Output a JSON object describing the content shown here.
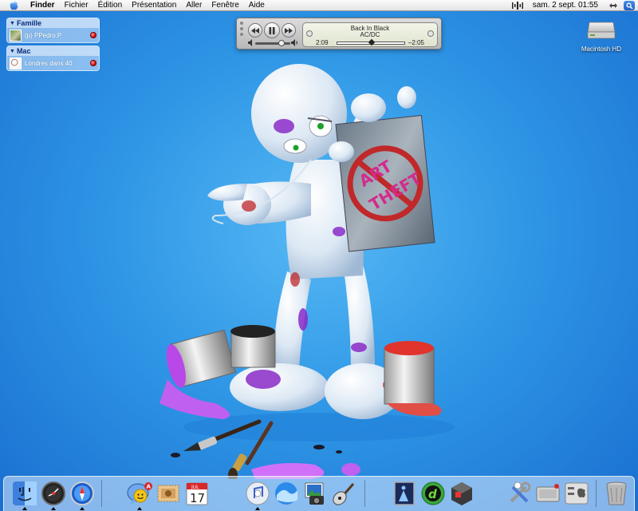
{
  "menubar": {
    "app_name": "Finder",
    "items": [
      "Fichier",
      "Édition",
      "Présentation",
      "Aller",
      "Fenêtre",
      "Aide"
    ],
    "clock": "sam. 2 sept. 01:55"
  },
  "buddy_list": {
    "groups": [
      {
        "name": "Famille",
        "buddies": [
          {
            "name": "(p) PPedro:P"
          }
        ]
      },
      {
        "name": "Mac",
        "buddies": [
          {
            "name": "Londres dans 40"
          }
        ]
      }
    ]
  },
  "itunes_player": {
    "track_title": "Back In Black",
    "artist": "AC/DC",
    "elapsed": "2:09",
    "remaining": "–2:05",
    "progress": 0.51,
    "volume": 0.75
  },
  "desktop": {
    "drive_label": "Macintosh HD"
  },
  "dock": {
    "apps": [
      {
        "id": "finder",
        "icon": "finder-icon",
        "running": true
      },
      {
        "id": "dashboard",
        "icon": "dashboard-icon",
        "running": true
      },
      {
        "id": "safari",
        "icon": "safari-icon",
        "running": true
      },
      {
        "id": "ichat",
        "icon": "ichat-icon",
        "running": true,
        "badge": "A"
      },
      {
        "id": "mail",
        "icon": "mail-stamp-icon",
        "running": false
      },
      {
        "id": "ical",
        "icon": "calendar-icon",
        "running": false,
        "date": "17",
        "month": "JUL"
      },
      {
        "id": "itunes",
        "icon": "itunes-icon",
        "running": true
      },
      {
        "id": "dvd",
        "icon": "wave-icon",
        "running": false
      },
      {
        "id": "iphoto",
        "icon": "iphoto-icon",
        "running": false
      },
      {
        "id": "garageband",
        "icon": "guitar-icon",
        "running": false
      },
      {
        "id": "preview",
        "icon": "preview-icon",
        "running": false
      },
      {
        "id": "dreamweaver",
        "icon": "dreamweaver-icon",
        "running": false
      },
      {
        "id": "omnigraffle",
        "icon": "cube-icon",
        "running": false
      },
      {
        "id": "utility",
        "icon": "tools-icon",
        "running": false
      },
      {
        "id": "disk",
        "icon": "disk-icon",
        "running": false
      },
      {
        "id": "prefs",
        "icon": "system-prefs-icon",
        "running": false
      },
      {
        "id": "trash",
        "icon": "trash-icon",
        "running": false
      }
    ]
  },
  "colors": {
    "desktop_blue": "#2f97e6",
    "paint_purple": "#b848e8",
    "paint_red": "#e0342c",
    "graffiti_magenta": "#d42a8c"
  }
}
